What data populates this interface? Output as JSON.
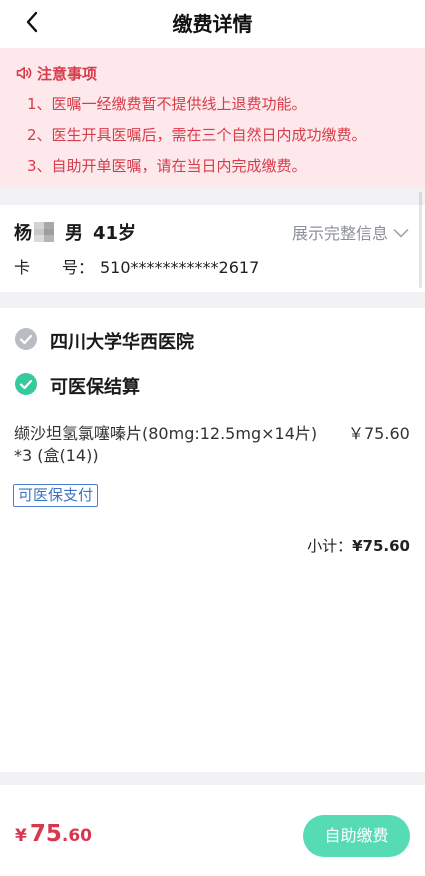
{
  "header": {
    "back_icon": "back-arrow-icon",
    "title": "缴费详情"
  },
  "notice": {
    "icon": "speaker-icon",
    "title": "注意事项",
    "items": [
      "1、医嘱一经缴费暂不提供线上退费功能。",
      "2、医生开具医嘱后，需在三个自然日内成功缴费。",
      "3、自助开单医嘱，请在当日内完成缴费。"
    ]
  },
  "patient": {
    "name": "杨",
    "gender": "男",
    "age": "41岁",
    "expand_label": "展示完整信息",
    "expand_icon": "chevron-down-icon",
    "card_label": [
      "卡",
      "号："
    ],
    "card_number": "510***********2617"
  },
  "order": {
    "hospital": "四川大学华西医院",
    "hospital_icon": "check-circle-icon",
    "settlement": "可医保结算",
    "settlement_icon": "check-circle-icon",
    "items": [
      {
        "name": "缬沙坦氢氯噻嗪片(80mg:12.5mg×14片) *3 (盒(14))",
        "price": "￥75.60",
        "badge": "可医保支付"
      }
    ],
    "subtotal_label": "小计：",
    "subtotal_value": "¥75.60"
  },
  "footer": {
    "currency": "¥",
    "amount_integer": "75",
    "amount_decimal": ".60",
    "pay_button": "自助缴费"
  },
  "colors": {
    "notice_text": "#d83c4b",
    "notice_background": "#fde9eb",
    "check_active": "#36c99c",
    "check_inactive": "#b9bcc3",
    "badge_blue": "#3f73c6",
    "price_red": "#d9364f",
    "pay_button": "#56dbb5",
    "page_background": "#f2f2f5"
  }
}
